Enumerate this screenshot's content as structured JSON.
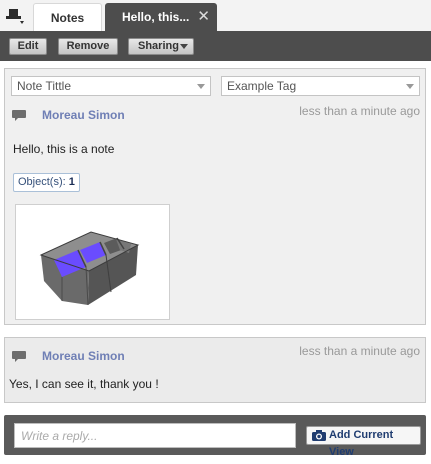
{
  "tabs": {
    "menu_icon": "hat-menu-icon",
    "notes_label": "Notes",
    "active_label": "Hello, this...",
    "close_glyph": "✕"
  },
  "toolbar": {
    "edit_label": "Edit",
    "remove_label": "Remove",
    "sharing_label": "Sharing"
  },
  "note": {
    "title_select": "Note Tittle",
    "tag_select": "Example Tag",
    "author": "Moreau Simon",
    "timestamp": "less than a minute ago",
    "text": "Hello, this is a note",
    "objects_label": "Object(s):",
    "objects_count": "1",
    "thumbnail_icon": "3d-model-thumbnail"
  },
  "reply": {
    "author": "Moreau Simon",
    "timestamp": "less than a minute ago",
    "text": "Yes, I can see it, thank you !"
  },
  "composer": {
    "placeholder": "Write a reply...",
    "add_view_label": "Add Current View",
    "camera_icon": "camera-icon"
  },
  "colors": {
    "toolbar_bg": "#4d4d4d",
    "author": "#6f7fb5",
    "accent_purple": "#6a4cff"
  }
}
